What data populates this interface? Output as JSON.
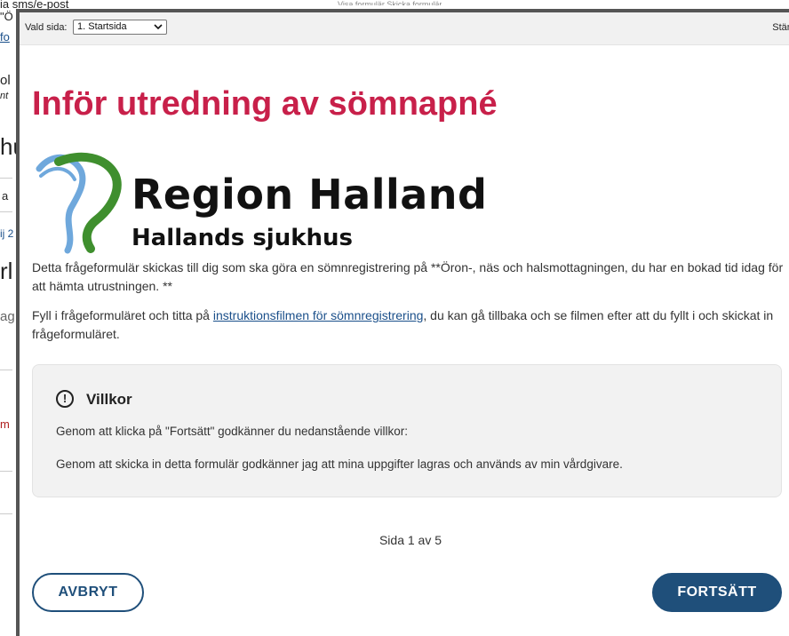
{
  "background_page": {
    "lines": [
      {
        "text": "ia sms/e-post"
      },
      {
        "text": "\"Ö"
      },
      {
        "text": "fo"
      },
      {
        "text": "ol"
      },
      {
        "text": "nt"
      },
      {
        "text": "hu"
      },
      {
        "text": "a"
      },
      {
        "text": "ij 2"
      },
      {
        "text": "rl"
      },
      {
        "text": "ag"
      },
      {
        "text": "m"
      }
    ],
    "top_strip": "Visa formulär   Skicka formulär"
  },
  "modal": {
    "toolbar": {
      "page_label": "Vald sida:",
      "page_select_value": "1. Startsida",
      "close_label": "Stäng"
    },
    "title": "Inför utredning av sömnapné",
    "logo": {
      "name": "Region Halland",
      "sub": "Hallands sjukhus",
      "colors": {
        "blue": "#6fa8dc",
        "green": "#3f8f2e"
      }
    },
    "intro": "Detta frågeformulär skickas till dig som ska göra en sömnregistrering på **Öron-, näs och halsmottagningen, du har en bokad tid idag för att hämta utrustningen. **",
    "instructions": {
      "before": "Fyll i frågeformuläret och titta på ",
      "link": "instruktionsfilmen för sömnregistrering",
      "after": ", du kan gå tillbaka och se filmen efter att du fyllt i och skickat in frågeformuläret."
    },
    "terms": {
      "icon": "exclamation-circle-icon",
      "title": "Villkor",
      "line1": "Genom att klicka på \"Fortsätt\" godkänner du nedanstående villkor:",
      "line2": "Genom att skicka in detta formulär godkänner jag att mina uppgifter lagras och används av min vårdgivare."
    },
    "pager": "Sida 1 av 5",
    "buttons": {
      "cancel": "AVBRYT",
      "continue": "FORTSÄTT"
    },
    "colors": {
      "title": "#c8204a",
      "primary": "#1f4f7a"
    }
  }
}
